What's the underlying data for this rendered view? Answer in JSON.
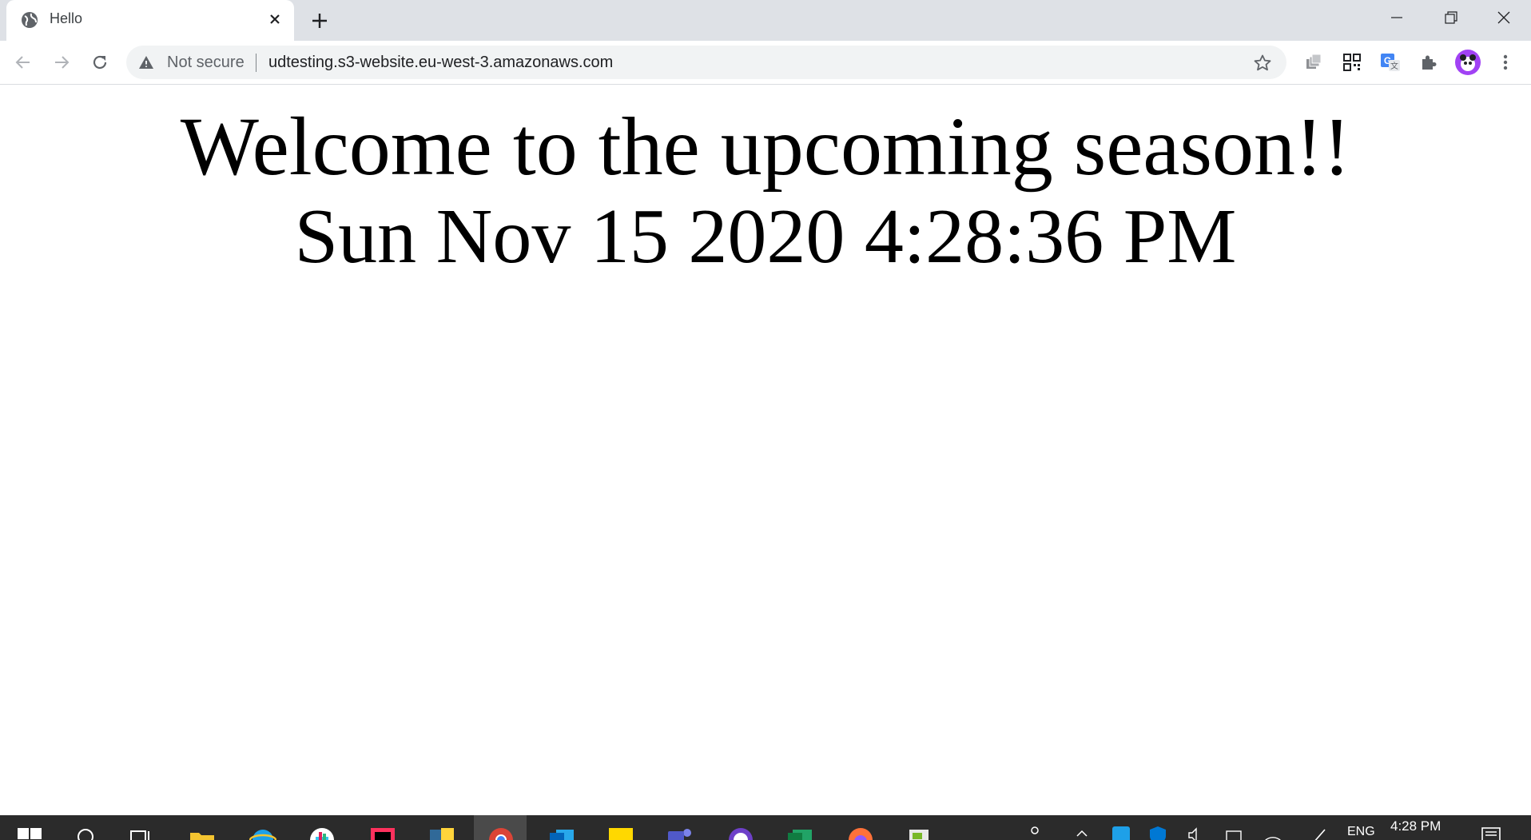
{
  "browser": {
    "tab": {
      "title": "Hello"
    },
    "address_bar": {
      "security_label": "Not secure",
      "url": "udtesting.s3-website.eu-west-3.amazonaws.com"
    },
    "extensions": [
      "tab-manager-icon",
      "qr-code-icon",
      "google-translate-icon",
      "extensions-puzzle-icon",
      "profile-avatar",
      "menu-kebab-icon"
    ]
  },
  "page": {
    "heading": "Welcome to the upcoming season!!",
    "datetime": "Sun Nov 15 2020 4:28:36 PM"
  },
  "taskbar": {
    "clock": "4:28 PM",
    "language": "ENG",
    "apps": [
      "start-icon",
      "search-icon",
      "task-view-icon",
      "file-explorer-icon",
      "internet-explorer-icon",
      "slack-icon",
      "intellij-icon",
      "python-icon",
      "chrome-icon",
      "outlook-icon",
      "sticky-notes-icon",
      "teams-icon",
      "github-desktop-icon",
      "excel-icon",
      "firefox-icon",
      "notepad-icon"
    ]
  },
  "colors": {
    "titlebar": "#dee1e6",
    "omnibox": "#f1f3f4",
    "taskbar": "#2b2b2b"
  }
}
